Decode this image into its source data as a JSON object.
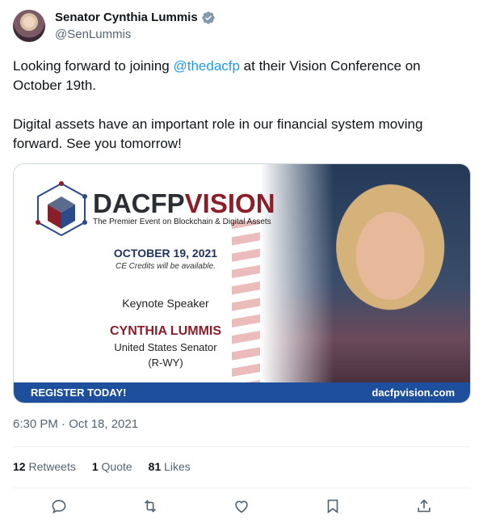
{
  "author": {
    "name": "Senator Cynthia Lummis",
    "handle": "@SenLummis",
    "verified_icon": "verified-badge-icon"
  },
  "tweet": {
    "line1_before": "Looking forward to joining ",
    "mention": "@thedacfp",
    "line1_after": " at their Vision Conference on October 19th.",
    "para2": "Digital assets have an important role in our financial system moving forward. See you tomorrow!"
  },
  "card": {
    "brand_part1": "DACFP",
    "brand_part2": "VISION",
    "tagline": "The Premier Event on Blockchain & Digital Assets",
    "date": "OCTOBER 19, 2021",
    "credits": "CE Credits will be available.",
    "keynote": "Keynote Speaker",
    "speaker": "CYNTHIA LUMMIS",
    "title": "United States Senator",
    "party": "(R-WY)",
    "register": "REGISTER TODAY!",
    "site": "dacfpvision.com"
  },
  "meta": {
    "timestamp": "6:30 PM · Oct 18, 2021"
  },
  "stats": {
    "retweets_count": "12",
    "retweets_label": "Retweets",
    "quotes_count": "1",
    "quotes_label": "Quote",
    "likes_count": "81",
    "likes_label": "Likes"
  },
  "colors": {
    "link": "#1d9bf0",
    "brand_red": "#8a1f2a",
    "bar_blue": "#1d4f9c"
  }
}
